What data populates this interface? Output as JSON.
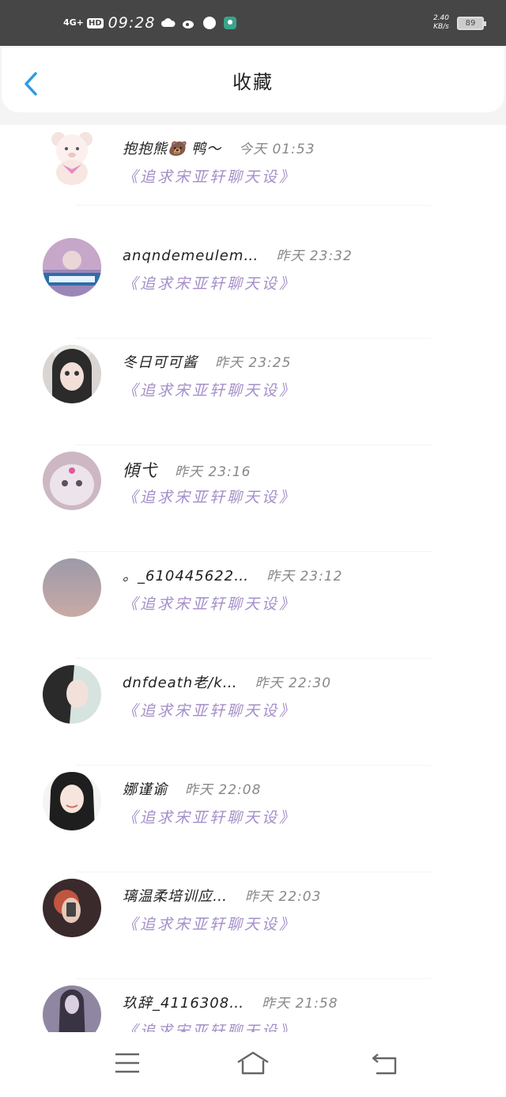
{
  "status_bar": {
    "network": "4G+",
    "hd": "HD",
    "time": "09:28",
    "speed_value": "2.40",
    "speed_unit": "KB/s",
    "battery": "89",
    "icons": [
      "cloud-icon",
      "weibo-icon",
      "compass-icon",
      "app-icon"
    ]
  },
  "header": {
    "title": "收藏",
    "back_icon": "chevron-left-icon"
  },
  "items": [
    {
      "name": "抱抱熊🐻 鸭～",
      "time": "今天 01:53",
      "subtitle": "《追求宋亚轩聊天设》"
    },
    {
      "name": "anqndemeulem…",
      "time": "昨天 23:32",
      "subtitle": "《追求宋亚轩聊天设》"
    },
    {
      "name": "冬日可可酱",
      "time": "昨天 23:25",
      "subtitle": "《追求宋亚轩聊天设》"
    },
    {
      "name": "傾弋",
      "time": "昨天 23:16",
      "subtitle": "《追求宋亚轩聊天设》"
    },
    {
      "name": "。_610445622…",
      "time": "昨天 23:12",
      "subtitle": "《追求宋亚轩聊天设》"
    },
    {
      "name": "dnfdeath老/k…",
      "time": "昨天 22:30",
      "subtitle": "《追求宋亚轩聊天设》"
    },
    {
      "name": "娜谨谕",
      "time": "昨天 22:08",
      "subtitle": "《追求宋亚轩聊天设》"
    },
    {
      "name": "璃温柔培训应…",
      "time": "昨天 22:03",
      "subtitle": "《追求宋亚轩聊天设》"
    },
    {
      "name": "玖辞_4116308…",
      "time": "昨天 21:58",
      "subtitle": "《追求宋亚轩聊天设》"
    }
  ],
  "nav": {
    "menu_icon": "menu-icon",
    "home_icon": "home-icon",
    "back_icon": "back-icon"
  }
}
